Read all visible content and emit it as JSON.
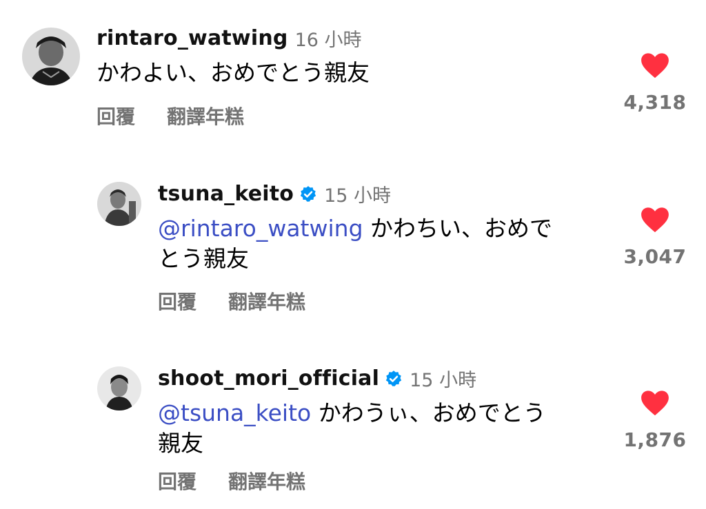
{
  "comments": [
    {
      "username": "rintaro_watwing",
      "verified": false,
      "time": "16 小時",
      "mention": "",
      "text_line1": "かわよい、おめでとう親友",
      "text_line2": "",
      "reply_label": "回覆",
      "translate_label": "翻譯年糕",
      "likes": "4,318"
    },
    {
      "username": "tsuna_keito",
      "verified": true,
      "time": "15 小時",
      "mention": "@rintaro_watwing",
      "text_line1": " かわちい、おめで",
      "text_line2": "とう親友",
      "reply_label": "回覆",
      "translate_label": "翻譯年糕",
      "likes": "3,047"
    },
    {
      "username": "shoot_mori_official",
      "verified": true,
      "time": "15 小時",
      "mention": "@tsuna_keito",
      "text_line1": " かわうぃ、おめでとう",
      "text_line2": "親友",
      "reply_label": "回覆",
      "translate_label": "翻譯年糕",
      "likes": "1,876"
    }
  ],
  "colors": {
    "heart": "#ff3040",
    "mention": "#3b4ec4",
    "muted": "#737373",
    "verified": "#0095f6"
  }
}
